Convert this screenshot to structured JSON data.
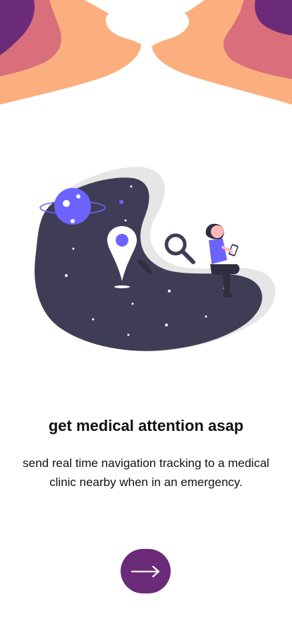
{
  "onboarding": {
    "title": "get medical attention asap",
    "description": "send real time navigation tracking to a medical clinic nearby when in an emergency.",
    "next_icon": "arrow-right-icon"
  },
  "theme": {
    "primary": "#6b2b78",
    "wave_dark": "#6b2b78",
    "wave_mid": "#d86f7a",
    "wave_light": "#fbae7e",
    "accent": "#6c63ff",
    "blob_dark": "#3f3d56",
    "blob_shadow": "#e6e6e6"
  },
  "illustration": {
    "name": "navigation-illustration",
    "icons": [
      "planet-icon",
      "location-pin-icon",
      "magnifier-icon",
      "woman-with-phone-figure"
    ]
  }
}
